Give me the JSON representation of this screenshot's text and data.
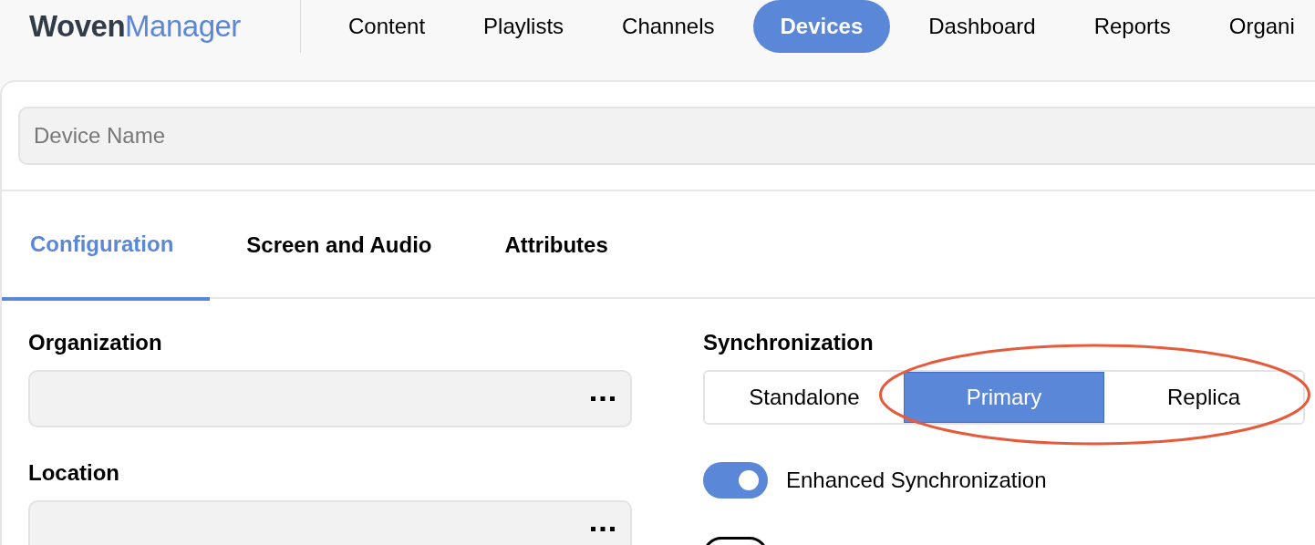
{
  "logo": {
    "part_1": "Woven",
    "part_2": "Manager"
  },
  "nav": [
    {
      "label": "Content",
      "selected": false
    },
    {
      "label": "Playlists",
      "selected": false
    },
    {
      "label": "Channels",
      "selected": false
    },
    {
      "label": "Devices",
      "selected": true
    },
    {
      "label": "Dashboard",
      "selected": false
    },
    {
      "label": "Reports",
      "selected": false
    },
    {
      "label": "Organi",
      "selected": false
    }
  ],
  "device_name": {
    "placeholder": "Device Name"
  },
  "tabs": [
    {
      "label": "Configuration",
      "selected": true
    },
    {
      "label": "Screen and Audio",
      "selected": false
    },
    {
      "label": "Attributes",
      "selected": false
    }
  ],
  "fields": [
    {
      "label": "Organization"
    },
    {
      "label": "Location"
    }
  ],
  "synchronization": {
    "label": "Synchronization",
    "options": [
      {
        "label": "Standalone",
        "selected": false
      },
      {
        "label": "Primary",
        "selected": true
      },
      {
        "label": "Replica",
        "selected": false
      }
    ]
  },
  "toggles": [
    {
      "label": "Enhanced Synchronization",
      "on": true
    },
    {
      "on": false
    }
  ]
}
